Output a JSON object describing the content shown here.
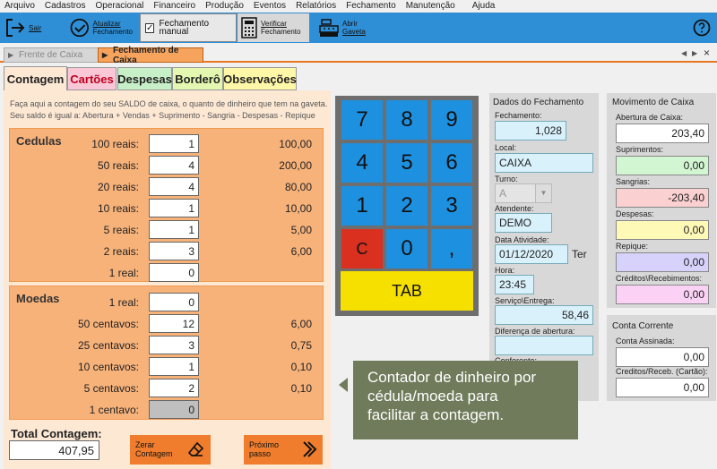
{
  "menu": [
    "Arquivo",
    "Cadastros",
    "Operacional",
    "Financeiro",
    "Produção",
    "Eventos",
    "Relatórios",
    "Fechamento",
    "Manutenção",
    "Ajuda"
  ],
  "toolbar": {
    "sair": "Sair",
    "atualizar": [
      "Atualizar",
      "Fechamento"
    ],
    "fechamento_manual": "Fechamento manual",
    "verificar": [
      "Verificar",
      "Fechamento"
    ],
    "abrir": [
      "Abrir",
      "Gaveta"
    ]
  },
  "doc_tabs": [
    "Frente de Caixa",
    "Fechamento de Caixa"
  ],
  "sub_tabs": [
    {
      "label": "Contagem",
      "color": "#fde8d4"
    },
    {
      "label": "Cartões",
      "color": "#f9c7d6"
    },
    {
      "label": "Despesas",
      "color": "#c8f0c8"
    },
    {
      "label": "Borderô",
      "color": "#e4f7b0"
    },
    {
      "label": "Observações",
      "color": "#fff7a8"
    }
  ],
  "contagem": {
    "info_line1": "Faça aqui a contagem do seu SALDO de caixa, o quanto de dinheiro que tem na gaveta.",
    "info_line2": "Seu saldo é igual a: Abertura + Vendas + Suprimento - Sangria - Despesas - Repique",
    "cedulas_title": "Cedulas",
    "cedulas": [
      {
        "label": "100 reais:",
        "qty": "1",
        "total": "100,00"
      },
      {
        "label": "50 reais:",
        "qty": "4",
        "total": "200,00"
      },
      {
        "label": "20 reais:",
        "qty": "4",
        "total": "80,00"
      },
      {
        "label": "10 reais:",
        "qty": "1",
        "total": "10,00"
      },
      {
        "label": "5 reais:",
        "qty": "1",
        "total": "5,00"
      },
      {
        "label": "2 reais:",
        "qty": "3",
        "total": "6,00"
      },
      {
        "label": "1 real:",
        "qty": "0",
        "total": ""
      }
    ],
    "moedas_title": "Moedas",
    "moedas": [
      {
        "label": "1 real:",
        "qty": "0",
        "total": ""
      },
      {
        "label": "50 centavos:",
        "qty": "12",
        "total": "6,00"
      },
      {
        "label": "25 centavos:",
        "qty": "3",
        "total": "0,75"
      },
      {
        "label": "10 centavos:",
        "qty": "1",
        "total": "0,10"
      },
      {
        "label": "5 centavos:",
        "qty": "2",
        "total": "0,10"
      },
      {
        "label": "1 centavo:",
        "qty": "0",
        "total": ""
      }
    ],
    "total_label": "Total Contagem:",
    "total_value": "407,95",
    "zerar": [
      "Zerar",
      "Contagem"
    ],
    "proximo": [
      "Próximo",
      "passo"
    ]
  },
  "keypad": [
    "7",
    "8",
    "9",
    "4",
    "5",
    "6",
    "1",
    "2",
    "3",
    "C",
    "0",
    ",",
    "TAB"
  ],
  "dados": {
    "title": "Dados do Fechamento",
    "fechamento_label": "Fechamento:",
    "fechamento": "1,028",
    "local_label": "Local:",
    "local": "CAIXA",
    "turno_label": "Turno:",
    "turno": "A",
    "atendente_label": "Atendente:",
    "atendente": "DEMO",
    "data_label": "Data Atividade:",
    "data": "01/12/2020",
    "dia": "Ter",
    "hora_label": "Hora:",
    "hora": "23:45",
    "servico_label": "Serviço\\Entrega:",
    "servico": "58,46",
    "diferenca_label": "Diferença de abertura:",
    "diferenca": "",
    "conferente_label": "Conferente:"
  },
  "movimento": {
    "title": "Movimento de Caixa",
    "items": [
      {
        "label": "Abertura de Caixa:",
        "value": "203,40",
        "color": "#ffffff"
      },
      {
        "label": "Suprimentos:",
        "value": "0,00",
        "color": "#d2f5d2"
      },
      {
        "label": "Sangrias:",
        "value": "-203,40",
        "color": "#fbd0d0"
      },
      {
        "label": "Despesas:",
        "value": "0,00",
        "color": "#fff9b8"
      },
      {
        "label": "Repique:",
        "value": "0,00",
        "color": "#d6d2fb"
      },
      {
        "label": "Créditos\\Recebimentos:",
        "value": "0,00",
        "color": "#fbd2f5"
      }
    ]
  },
  "conta": {
    "title": "Conta Corrente",
    "items": [
      {
        "label": "Conta Assinada:",
        "value": "0,00"
      },
      {
        "label": "Creditos/Receb. (Cartão):",
        "value": "0,00"
      }
    ]
  },
  "tooltip": [
    "Contador de dinheiro por",
    "cédula/moeda para",
    "facilitar a contagem."
  ],
  "colors": {
    "toolbar": "#2f8fd6",
    "accent": "#e87722",
    "keypad_key": "#1e90e0",
    "key_c": "#d93020",
    "key_tab": "#f5e000",
    "tooltip": "#6f7b5a"
  }
}
